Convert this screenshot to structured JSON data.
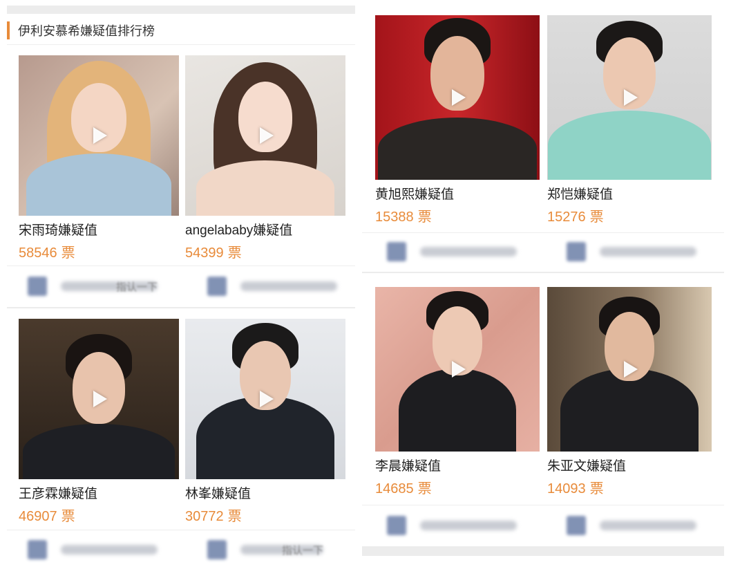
{
  "section": {
    "title": "伊利安慕希嫌疑值排行榜"
  },
  "unit": "票",
  "cards": [
    {
      "name": "宋雨琦嫌疑值",
      "votes": "58546",
      "avatar_alt": "song-yuqi-photo"
    },
    {
      "name": "angelababy嫌疑值",
      "votes": "54399",
      "avatar_alt": "angelababy-photo"
    },
    {
      "name": "王彦霖嫌疑值",
      "votes": "46907",
      "avatar_alt": "wang-yanlin-photo"
    },
    {
      "name": "林峯嫌疑值",
      "votes": "30772",
      "avatar_alt": "lin-feng-photo"
    },
    {
      "name": "黄旭熙嫌疑值",
      "votes": "15388",
      "avatar_alt": "huang-xuxi-photo"
    },
    {
      "name": "郑恺嫌疑值",
      "votes": "15276",
      "avatar_alt": "zheng-kai-photo"
    },
    {
      "name": "李晨嫌疑值",
      "votes": "14685",
      "avatar_alt": "li-chen-photo"
    },
    {
      "name": "朱亚文嫌疑值",
      "votes": "14093",
      "avatar_alt": "zhu-yawen-photo"
    }
  ],
  "blurred": [
    {
      "text": "指认一下"
    },
    {
      "text": ""
    },
    {
      "text": ""
    },
    {
      "text": "指认一下"
    },
    {
      "text": ""
    },
    {
      "text": ""
    },
    {
      "text": ""
    },
    {
      "text": ""
    }
  ],
  "colors": {
    "accent": "#e88b3a",
    "name": "#222222",
    "divider": "#eeeeee"
  }
}
